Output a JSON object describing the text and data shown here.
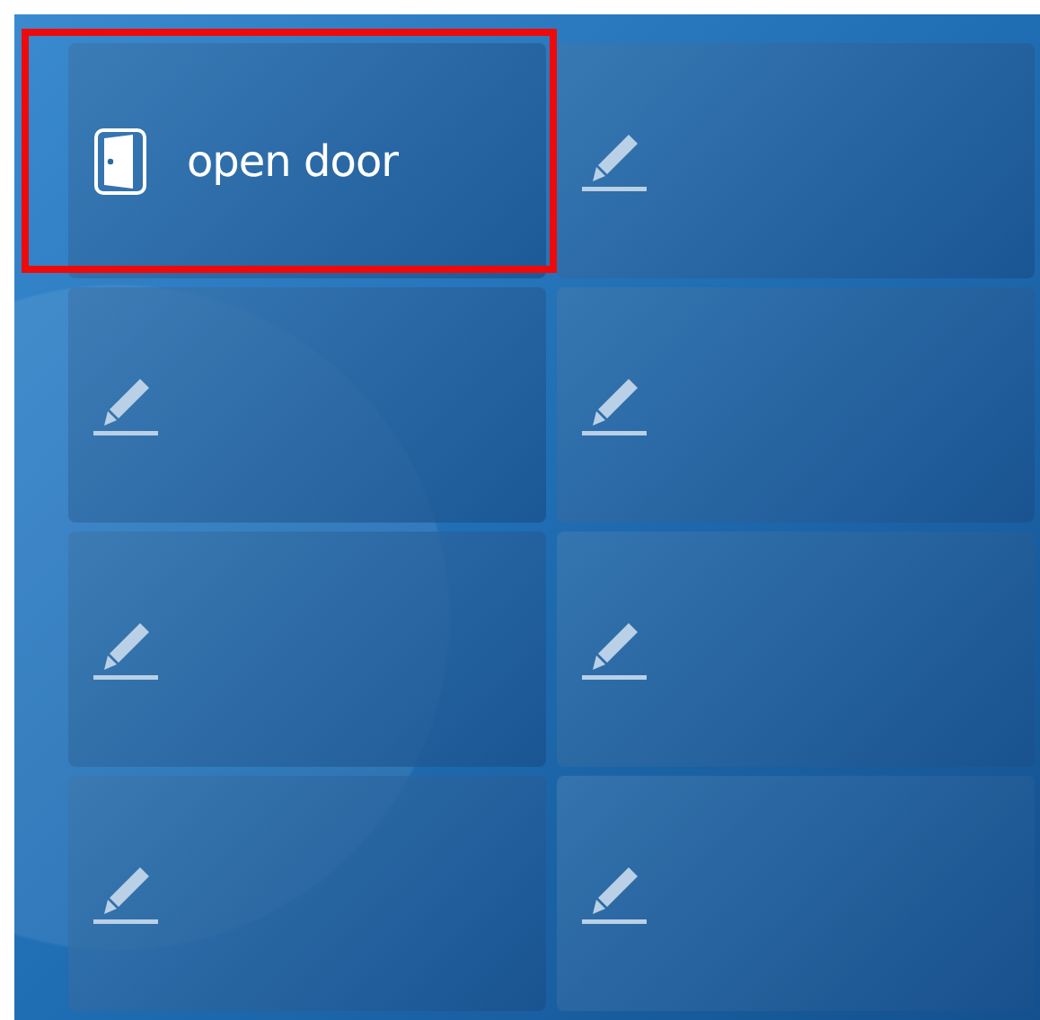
{
  "tiles": [
    {
      "kind": "action",
      "label": "open door",
      "highlighted": true
    },
    {
      "kind": "empty",
      "highlighted": false
    },
    {
      "kind": "empty",
      "highlighted": false
    },
    {
      "kind": "empty",
      "highlighted": false
    },
    {
      "kind": "empty",
      "highlighted": false
    },
    {
      "kind": "empty",
      "highlighted": false
    },
    {
      "kind": "empty",
      "highlighted": false
    },
    {
      "kind": "empty",
      "highlighted": false
    }
  ]
}
